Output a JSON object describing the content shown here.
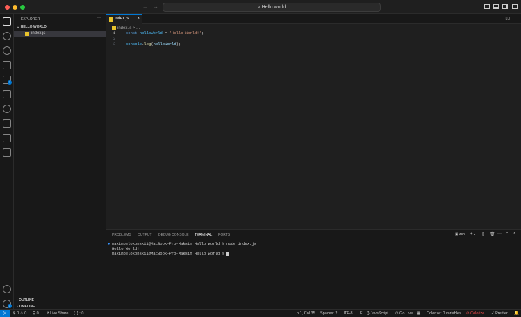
{
  "titlebar": {
    "search": "Hello world"
  },
  "sidebar": {
    "title": "EXPLORER",
    "folder": "HELLO WORLD",
    "files": [
      "index.js"
    ],
    "outline": "OUTLINE",
    "timeline": "TIMELINE"
  },
  "activity": {
    "extensions_badge": "1",
    "accounts_badge": "1"
  },
  "editor": {
    "tab": "index.js",
    "breadcrumb": "index.js > ...",
    "lines": [
      {
        "n": "1",
        "code": "const helloWorld = 'Hello World!';"
      },
      {
        "n": "2",
        "code": ""
      },
      {
        "n": "3",
        "code": "console.log(helloWorld);"
      }
    ]
  },
  "panel": {
    "tabs": [
      "PROBLEMS",
      "OUTPUT",
      "DEBUG CONSOLE",
      "TERMINAL",
      "PORTS"
    ],
    "shell": "zsh",
    "terminal": [
      "maximbelokonskii@MacBook-Pro-Maksim Hello world % node index.js",
      "Hello World!",
      "maximbelokonskii@MacBook-Pro-Maksim Hello world % "
    ]
  },
  "status": {
    "errors": "0",
    "warnings": "0",
    "ports": "0",
    "liveshare": "Live Share",
    "braces": "{..} : 0",
    "position": "Ln 1, Col 35",
    "spaces": "Spaces: 2",
    "encoding": "UTF-8",
    "eol": "LF",
    "language": "JavaScript",
    "golive": "Go Live",
    "colorize": "Colorize: 0 variables",
    "colorize2": "Colorize",
    "prettier": "Prettier"
  }
}
